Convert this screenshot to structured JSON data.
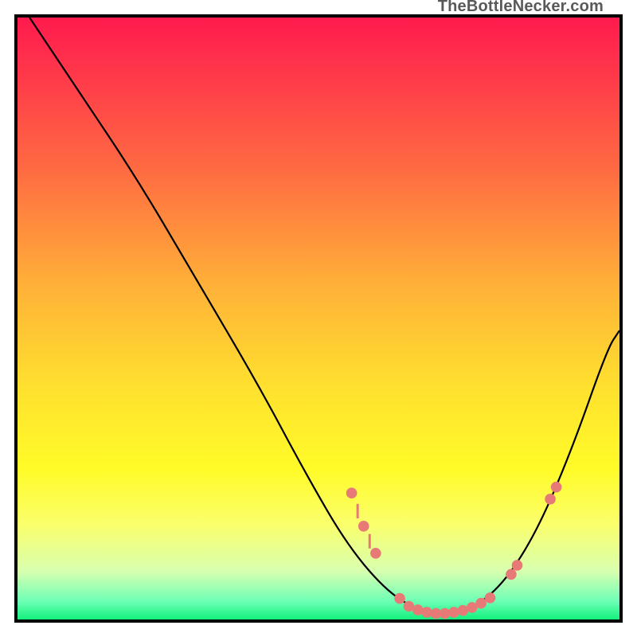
{
  "watermark": "TheBottleNecker.com",
  "colors": {
    "gradient_top": "#ff1a4d",
    "gradient_bottom": "#13f07c",
    "curve": "#000000",
    "marker": "#e77a77",
    "frame": "#000000"
  },
  "chart_data": {
    "type": "line",
    "title": "",
    "xlabel": "",
    "ylabel": "",
    "x_range": [
      0,
      100
    ],
    "y_range": [
      0,
      100
    ],
    "series": [
      {
        "name": "bottleneck-curve",
        "points": [
          {
            "x": 2,
            "y": 100
          },
          {
            "x": 10,
            "y": 88
          },
          {
            "x": 20,
            "y": 73
          },
          {
            "x": 30,
            "y": 56
          },
          {
            "x": 40,
            "y": 39
          },
          {
            "x": 48,
            "y": 24
          },
          {
            "x": 55,
            "y": 12
          },
          {
            "x": 62,
            "y": 4
          },
          {
            "x": 68,
            "y": 1
          },
          {
            "x": 74,
            "y": 1
          },
          {
            "x": 80,
            "y": 5
          },
          {
            "x": 86,
            "y": 14
          },
          {
            "x": 92,
            "y": 28
          },
          {
            "x": 98,
            "y": 45
          },
          {
            "x": 100,
            "y": 48
          }
        ]
      }
    ],
    "markers": [
      {
        "x": 55.5,
        "y": 21,
        "kind": "dot"
      },
      {
        "x": 56.5,
        "y": 18,
        "kind": "tick"
      },
      {
        "x": 57.5,
        "y": 15.5,
        "kind": "dot"
      },
      {
        "x": 58.5,
        "y": 13,
        "kind": "tick"
      },
      {
        "x": 59.5,
        "y": 11,
        "kind": "dot"
      },
      {
        "x": 63.5,
        "y": 3.5,
        "kind": "dot"
      },
      {
        "x": 65,
        "y": 2.2,
        "kind": "dot"
      },
      {
        "x": 66.5,
        "y": 1.6,
        "kind": "dot"
      },
      {
        "x": 68,
        "y": 1.2,
        "kind": "dot"
      },
      {
        "x": 69.5,
        "y": 1.0,
        "kind": "dot"
      },
      {
        "x": 71,
        "y": 1.0,
        "kind": "dot"
      },
      {
        "x": 72.5,
        "y": 1.2,
        "kind": "dot"
      },
      {
        "x": 74,
        "y": 1.5,
        "kind": "dot"
      },
      {
        "x": 75.5,
        "y": 2.0,
        "kind": "dot"
      },
      {
        "x": 77,
        "y": 2.7,
        "kind": "dot"
      },
      {
        "x": 78.5,
        "y": 3.6,
        "kind": "dot"
      },
      {
        "x": 82,
        "y": 7.5,
        "kind": "dot"
      },
      {
        "x": 83,
        "y": 9,
        "kind": "dot"
      },
      {
        "x": 88.5,
        "y": 20,
        "kind": "dot"
      },
      {
        "x": 89.5,
        "y": 22,
        "kind": "dot"
      }
    ]
  }
}
